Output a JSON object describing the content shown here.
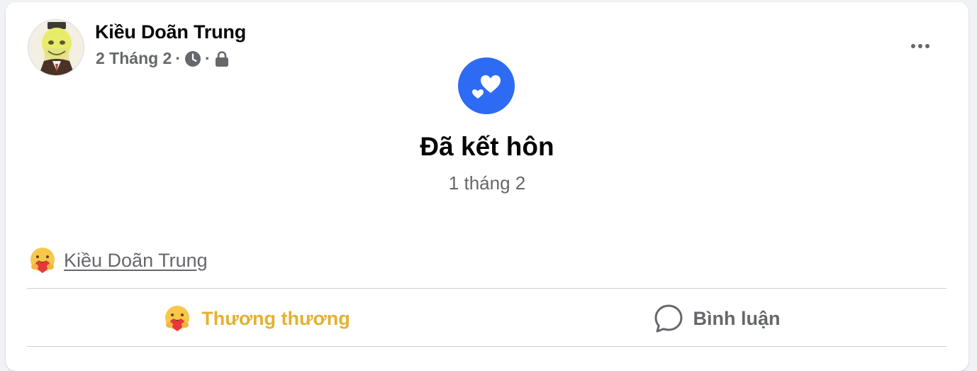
{
  "post": {
    "author": "Kiều Doãn Trung",
    "date": "2 Tháng 2",
    "separator": "·",
    "life_event": {
      "title": "Đã kết hôn",
      "date": "1 tháng 2",
      "icon": "hearts-icon"
    },
    "reactions": {
      "reactor_name": "Kiều Doãn Trung",
      "type": "care-emoji"
    },
    "actions": {
      "love_label": "Thương thương",
      "comment_label": "Bình luận"
    }
  },
  "colors": {
    "icon_blue": "#2d6bf4",
    "care_yellow": "#e4b12f",
    "muted": "#65676b"
  }
}
